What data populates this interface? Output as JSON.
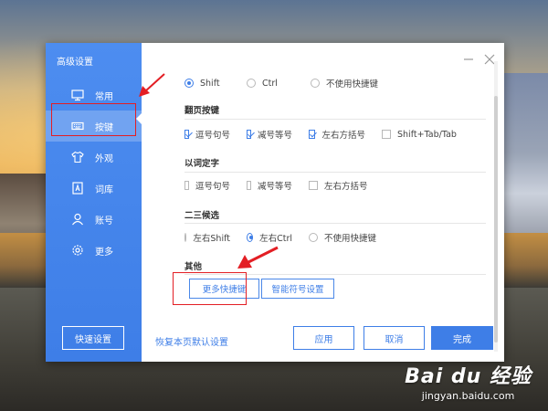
{
  "dialog": {
    "title": "高级设置",
    "nav": [
      {
        "label": "常用",
        "icon": "monitor-icon"
      },
      {
        "label": "按键",
        "icon": "keyboard-icon",
        "active": true
      },
      {
        "label": "外观",
        "icon": "shirt-icon"
      },
      {
        "label": "词库",
        "icon": "dictionary-icon"
      },
      {
        "label": "账号",
        "icon": "user-icon"
      },
      {
        "label": "更多",
        "icon": "gear-icon"
      }
    ],
    "quick_setup": "快速设置",
    "switch_row": [
      {
        "label": "Shift",
        "checked": true
      },
      {
        "label": "Ctrl",
        "checked": false
      },
      {
        "label": "不使用快捷键",
        "checked": false
      }
    ],
    "page_flip": {
      "title": "翻页按键",
      "options": [
        {
          "label": "逗号句号",
          "checked": true
        },
        {
          "label": "减号等号",
          "checked": true
        },
        {
          "label": "左右方括号",
          "checked": true
        },
        {
          "label": "Shift+Tab/Tab",
          "checked": false
        }
      ]
    },
    "word_select": {
      "title": "以词定字",
      "options": [
        {
          "label": "逗号句号",
          "checked": false
        },
        {
          "label": "减号等号",
          "checked": false
        },
        {
          "label": "左右方括号",
          "checked": false
        }
      ]
    },
    "second_third": {
      "title": "二三候选",
      "options": [
        {
          "label": "左右Shift",
          "checked": false
        },
        {
          "label": "左右Ctrl",
          "checked": true
        },
        {
          "label": "不使用快捷键",
          "checked": false
        }
      ]
    },
    "other": {
      "title": "其他",
      "more_shortcuts": "更多快捷键",
      "smart_symbols": "智能符号设置"
    },
    "footer": {
      "restore_default": "恢复本页默认设置",
      "apply": "应用",
      "cancel": "取消",
      "done": "完成"
    }
  },
  "watermark": {
    "logo": "Bai du 经验",
    "url": "jingyan.baidu.com"
  },
  "colors": {
    "accent": "#3e7ee7",
    "sidebar": "#4d8df0",
    "annotation_red": "#e31e24"
  }
}
